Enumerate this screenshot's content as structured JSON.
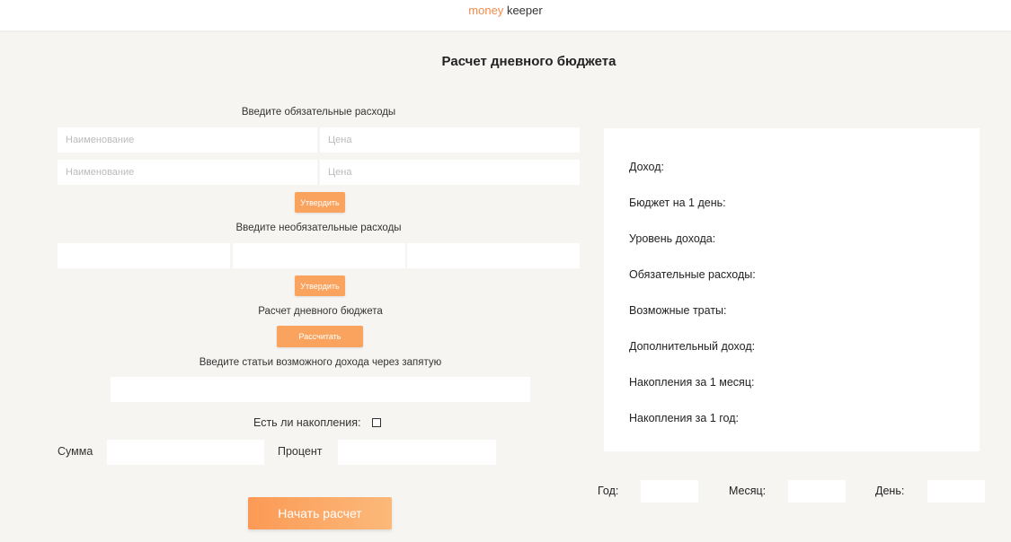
{
  "header": {
    "logo_part1": "money",
    "logo_part2": "keeper"
  },
  "title": "Расчет дневного бюджета",
  "mandatory": {
    "label": "Введите обязательные расходы",
    "name_placeholder": "Наименование",
    "price_placeholder": "Цена",
    "confirm": "Утвердить"
  },
  "optional": {
    "label": "Введите необязательные расходы",
    "confirm": "Утвердить"
  },
  "daily": {
    "label": "Расчет дневного бюджета",
    "calc": "Рассчитать"
  },
  "income_items": {
    "label": "Введите статьи возможного дохода через запятую"
  },
  "savings": {
    "question": "Есть ли накопления:",
    "sum_label": "Сумма",
    "percent_label": "Процент"
  },
  "start_button": "Начать расчет",
  "results": {
    "income": "Доход:",
    "budget_per_day": "Бюджет на 1 день:",
    "income_level": "Уровень дохода:",
    "mandatory_expenses": "Обязательные расходы:",
    "possible_spending": "Возможные траты:",
    "additional_income": "Дополнительный доход:",
    "savings_month": "Накопления за 1 месяц:",
    "savings_year": "Накопления за 1 год:"
  },
  "date": {
    "year": "Год:",
    "month": "Месяц:",
    "day": "День:"
  },
  "colors": {
    "accent": "#f08a4b",
    "button": "#f9a35e",
    "background": "#f7f5f2"
  }
}
